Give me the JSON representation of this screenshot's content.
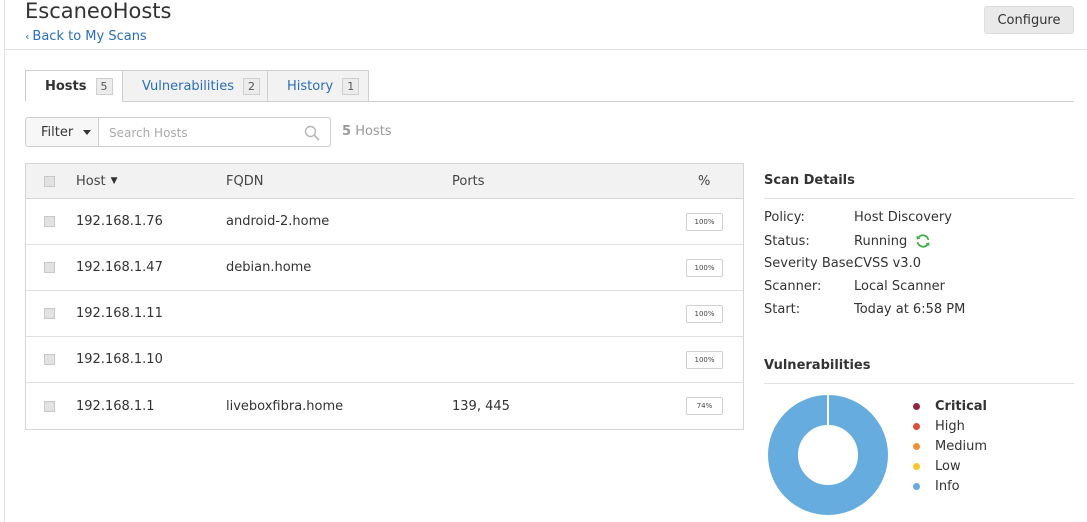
{
  "header": {
    "title": "EscaneoHosts",
    "back_label": "Back to My Scans",
    "configure_label": "Configure"
  },
  "tabs": [
    {
      "label": "Hosts",
      "count": "5",
      "active": true
    },
    {
      "label": "Vulnerabilities",
      "count": "2",
      "active": false
    },
    {
      "label": "History",
      "count": "1",
      "active": false
    }
  ],
  "toolbar": {
    "filter_label": "Filter",
    "search_placeholder": "Search Hosts",
    "host_count_num": "5",
    "host_count_word": "Hosts"
  },
  "table": {
    "columns": {
      "host": "Host",
      "fqdn": "FQDN",
      "ports": "Ports",
      "percent": "%"
    },
    "sort_indicator": "▼",
    "rows": [
      {
        "host": "192.168.1.76",
        "fqdn": "android-2.home",
        "ports": "",
        "percent": "100%"
      },
      {
        "host": "192.168.1.47",
        "fqdn": "debian.home",
        "ports": "",
        "percent": "100%"
      },
      {
        "host": "192.168.1.11",
        "fqdn": "",
        "ports": "",
        "percent": "100%"
      },
      {
        "host": "192.168.1.10",
        "fqdn": "",
        "ports": "",
        "percent": "100%"
      },
      {
        "host": "192.168.1.1",
        "fqdn": "liveboxfibra.home",
        "ports": "139, 445",
        "percent": "74%"
      }
    ]
  },
  "scan_details": {
    "title": "Scan Details",
    "policy_label": "Policy:",
    "policy_value": "Host Discovery",
    "status_label": "Status:",
    "status_value": "Running",
    "severity_label": "Severity Base:",
    "severity_value": "CVSS v3.0",
    "scanner_label": "Scanner:",
    "scanner_value": "Local Scanner",
    "start_label": "Start:",
    "start_value": "Today at 6:58 PM"
  },
  "vulnerabilities": {
    "title": "Vulnerabilities",
    "legend": [
      {
        "label": "Critical",
        "color": "#91243e"
      },
      {
        "label": "High",
        "color": "#dd4b39"
      },
      {
        "label": "Medium",
        "color": "#ee9336"
      },
      {
        "label": "Low",
        "color": "#fdc431"
      },
      {
        "label": "Info",
        "color": "#67acdf"
      }
    ],
    "info_share": 1.0
  },
  "icons": {
    "back": "chevron-left-icon",
    "search": "search-icon",
    "running": "refresh-icon",
    "filter": "caret-down-icon"
  }
}
